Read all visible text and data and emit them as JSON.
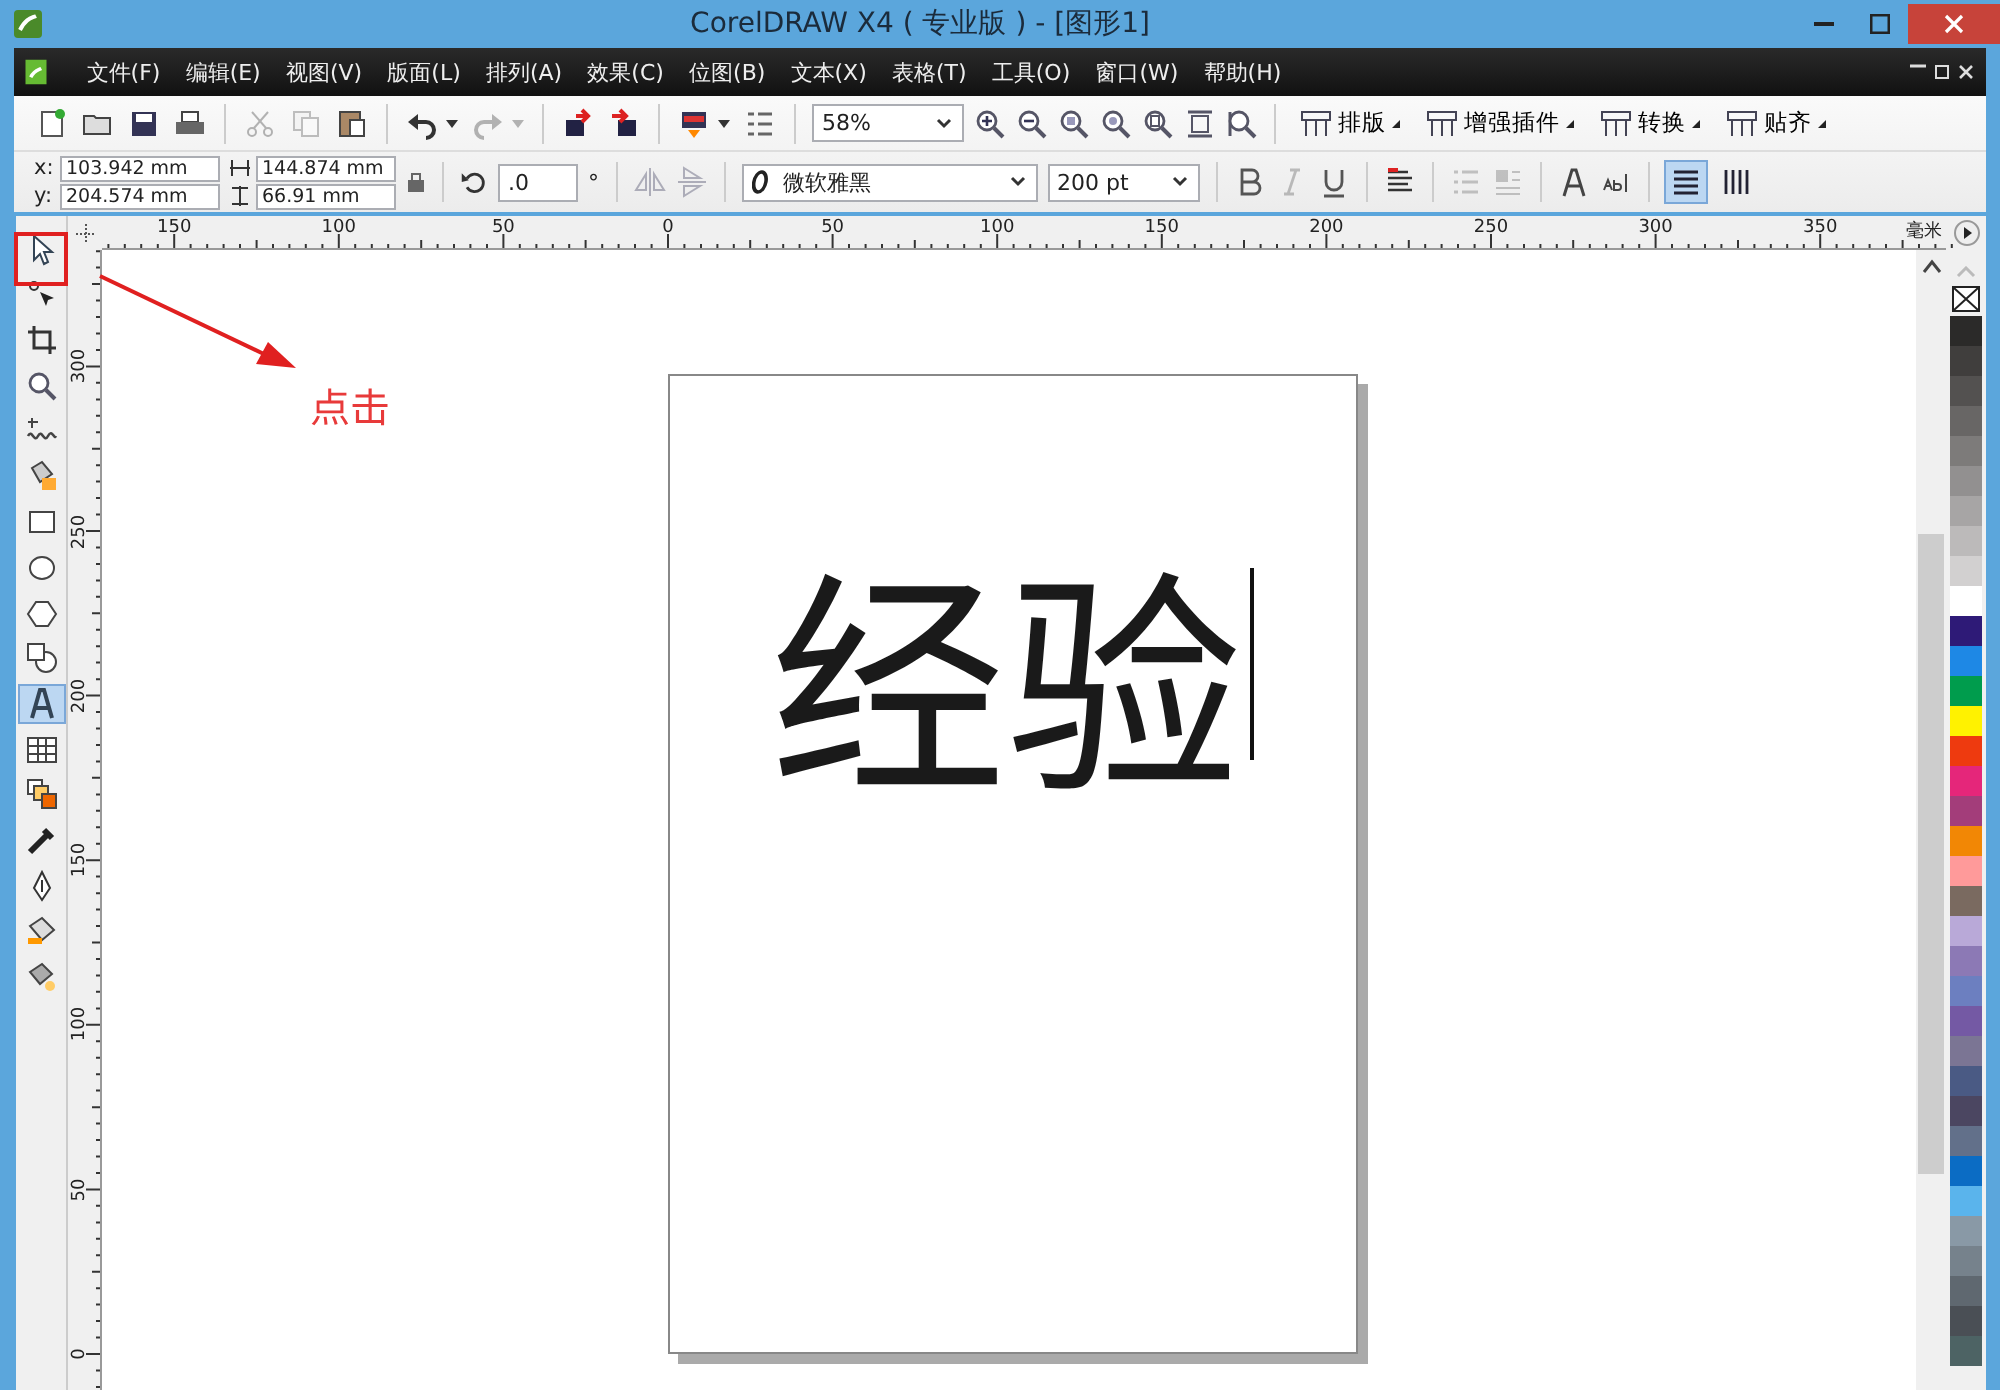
{
  "window": {
    "title": "CorelDRAW X4 ( 专业版 ) - [图形1]"
  },
  "menu_bar": {
    "items": [
      "文件(F)",
      "编辑(E)",
      "视图(V)",
      "版面(L)",
      "排列(A)",
      "效果(C)",
      "位图(B)",
      "文本(X)",
      "表格(T)",
      "工具(O)",
      "窗口(W)",
      "帮助(H)"
    ]
  },
  "toolbar": {
    "buttons": [
      {
        "kind": "new",
        "disabled": false
      },
      {
        "kind": "open",
        "disabled": false
      },
      {
        "kind": "save",
        "disabled": false
      },
      {
        "kind": "print",
        "disabled": false
      },
      {
        "kind": "sep"
      },
      {
        "kind": "cut",
        "disabled": true
      },
      {
        "kind": "copy",
        "disabled": true
      },
      {
        "kind": "paste",
        "disabled": false
      },
      {
        "kind": "sep"
      },
      {
        "kind": "undo",
        "disabled": false
      },
      {
        "kind": "redo",
        "disabled": true
      },
      {
        "kind": "sep"
      },
      {
        "kind": "import",
        "disabled": false
      },
      {
        "kind": "export",
        "disabled": false
      },
      {
        "kind": "sep"
      },
      {
        "kind": "launcher",
        "disabled": false
      },
      {
        "kind": "options",
        "disabled": false
      }
    ],
    "zoom_level": "58%",
    "zoom_buttons": [
      {
        "kind": "zoom-in"
      },
      {
        "kind": "zoom-out"
      },
      {
        "kind": "zoom-selected"
      },
      {
        "kind": "zoom-all"
      },
      {
        "kind": "zoom-page"
      },
      {
        "kind": "zoom-width"
      },
      {
        "kind": "zoom-height"
      }
    ],
    "plugin_buttons": [
      {
        "label": "排版"
      },
      {
        "label": "增强插件"
      },
      {
        "label": "转换"
      },
      {
        "label": "贴齐"
      }
    ]
  },
  "property_bar": {
    "x_label": "x:",
    "x_value": "103.942 mm",
    "y_label": "y:",
    "y_value": "204.574 mm",
    "width_value": "144.874 mm",
    "height_value": "66.91 mm",
    "rotation_value": ".0",
    "degree_sign": "°",
    "font_name": "微软雅黑",
    "font_size": "200 pt",
    "format_buttons": [
      {
        "kind": "bold",
        "disabled": false
      },
      {
        "kind": "italic",
        "disabled": true
      },
      {
        "kind": "underline",
        "disabled": false
      }
    ],
    "paragraph_buttons": [
      {
        "kind": "bullet",
        "disabled": true
      },
      {
        "kind": "drop-cap",
        "disabled": true
      }
    ],
    "orientation": [
      {
        "kind": "horizontal",
        "selected": true
      },
      {
        "kind": "vertical",
        "selected": false
      }
    ]
  },
  "toolbox": [
    {
      "kind": "pick",
      "selected": false
    },
    {
      "kind": "shape",
      "selected": false
    },
    {
      "kind": "crop",
      "selected": false
    },
    {
      "kind": "zoom",
      "selected": false
    },
    {
      "kind": "freehand",
      "selected": false
    },
    {
      "kind": "smart-fill",
      "selected": false
    },
    {
      "kind": "rectangle",
      "selected": false
    },
    {
      "kind": "ellipse",
      "selected": false
    },
    {
      "kind": "polygon",
      "selected": false
    },
    {
      "kind": "basic-shapes",
      "selected": false
    },
    {
      "kind": "text",
      "selected": true
    },
    {
      "kind": "table",
      "selected": false
    },
    {
      "kind": "blend",
      "selected": false
    },
    {
      "kind": "eyedropper",
      "selected": false
    },
    {
      "kind": "outline",
      "selected": false
    },
    {
      "kind": "fill",
      "selected": false
    },
    {
      "kind": "interactive-fill",
      "selected": false
    }
  ],
  "rulers": {
    "top_labels": [
      "150",
      "100",
      "50",
      "0",
      "50",
      "100",
      "150",
      "200",
      "250",
      "300",
      "350"
    ],
    "unit": "毫米",
    "left_labels": [
      "300",
      "250",
      "200",
      "150",
      "100",
      "50",
      "0"
    ]
  },
  "document": {
    "text": "经验"
  },
  "annotation": {
    "label": "点击"
  },
  "palette": {
    "swatches": [
      {
        "color": "#2b2a29"
      },
      {
        "color": "#403e3d"
      },
      {
        "color": "#535150"
      },
      {
        "color": "#686665"
      },
      {
        "color": "#7d7b7a"
      },
      {
        "color": "#929090"
      },
      {
        "color": "#a7a5a5"
      },
      {
        "color": "#bcbaba"
      },
      {
        "color": "#d2d0d0"
      },
      {
        "color": "#ffffff"
      },
      {
        "color": "#2e1a77"
      },
      {
        "color": "#1e88e5"
      },
      {
        "color": "#009c4d"
      },
      {
        "color": "#fff200"
      },
      {
        "color": "#ee3a0f"
      },
      {
        "color": "#e5267a"
      },
      {
        "color": "#a33d7a"
      },
      {
        "color": "#f28705"
      },
      {
        "color": "#ff9a9a"
      },
      {
        "color": "#7a6a60"
      },
      {
        "color": "#b9a9d8"
      },
      {
        "color": "#8c79b5"
      },
      {
        "color": "#6c7fc0"
      },
      {
        "color": "#7459a4"
      },
      {
        "color": "#7b7594"
      },
      {
        "color": "#4a5a84"
      },
      {
        "color": "#4b4661"
      },
      {
        "color": "#62708a"
      },
      {
        "color": "#0b6cc4"
      },
      {
        "color": "#5ab4ec"
      },
      {
        "color": "#8999a6"
      },
      {
        "color": "#76828c"
      },
      {
        "color": "#5f6870"
      },
      {
        "color": "#4a4f55"
      },
      {
        "color": "#4d6364"
      }
    ]
  }
}
